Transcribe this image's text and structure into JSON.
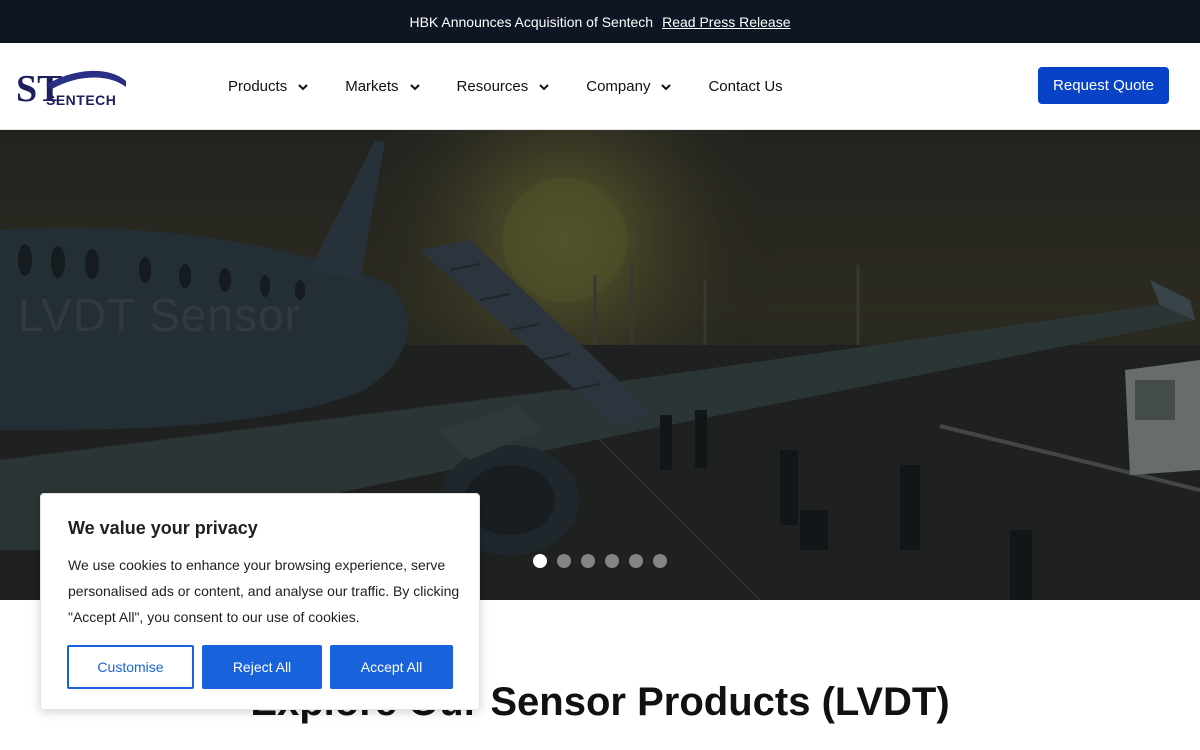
{
  "announcement": {
    "text": "HBK Announces Acquisition of Sentech",
    "link": "Read Press Release"
  },
  "header": {
    "logo_text": "ST",
    "logo_subtext": "SENTECH",
    "nav": [
      {
        "label": "Products",
        "has_dropdown": true
      },
      {
        "label": "Markets",
        "has_dropdown": true
      },
      {
        "label": "Resources",
        "has_dropdown": true
      },
      {
        "label": "Company",
        "has_dropdown": true
      },
      {
        "label": "Contact Us",
        "has_dropdown": false
      }
    ],
    "cta": "Request Quote"
  },
  "hero": {
    "ghost_text": "LVDT Sensor",
    "slide_count": 6,
    "active_slide": 1
  },
  "section": {
    "title": "Explore Our Sensor Products (LVDT)"
  },
  "cookie": {
    "title": "We value your privacy",
    "body": "We use cookies to enhance your browsing experience, serve personalised ads or content, and analyse our traffic. By clicking \"Accept All\", you consent to our use of cookies.",
    "customise": "Customise",
    "reject": "Reject All",
    "accept": "Accept All"
  },
  "colors": {
    "announcement_bg": "#0e1624",
    "brand_blue": "#0742c7",
    "cookie_blue": "#1863dc",
    "logo_navy": "#1c1f5e"
  },
  "icons": {
    "nav_dropdown": "chevron-down-icon",
    "logo": "sentech-logo"
  }
}
